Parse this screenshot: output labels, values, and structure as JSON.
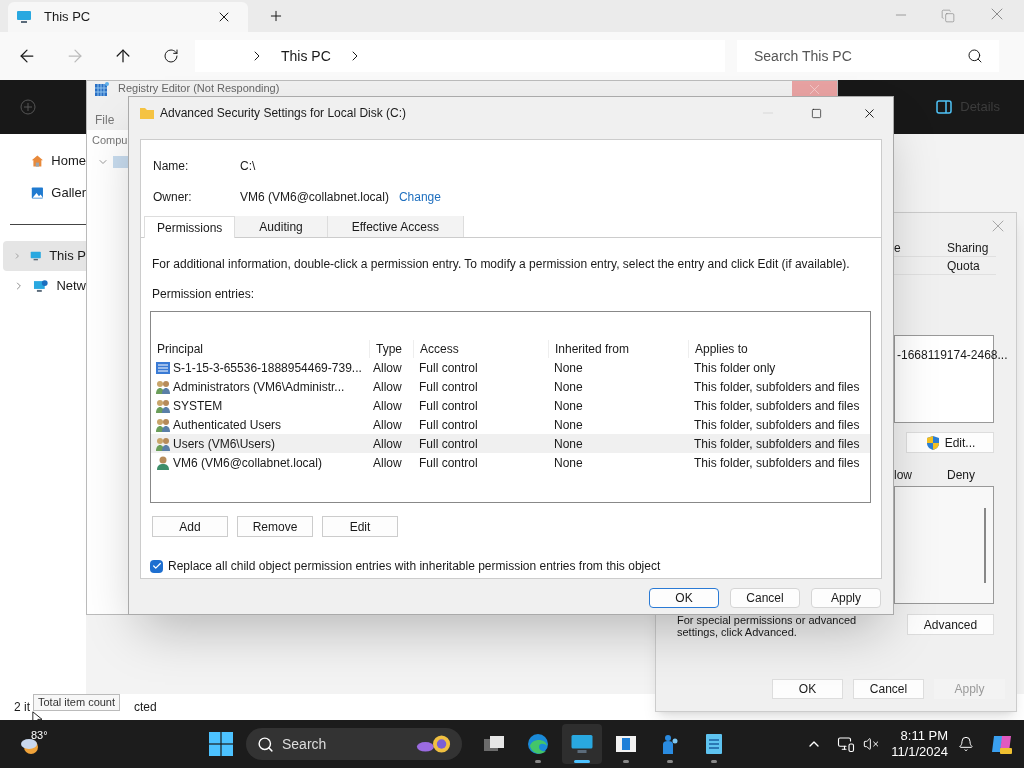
{
  "explorer": {
    "tab_title": "This PC",
    "breadcrumb": [
      "This PC"
    ],
    "search": {
      "placeholder": "Search This PC"
    },
    "details_label": "Details",
    "sidebar": [
      {
        "kind": "home",
        "label": "Home",
        "selected": false,
        "expandable": false
      },
      {
        "kind": "gallery",
        "label": "Galler",
        "selected": false,
        "expandable": false
      },
      {
        "kind": "pc",
        "label": "This P",
        "selected": true,
        "expandable": true
      },
      {
        "kind": "network",
        "label": "Netw",
        "selected": false,
        "expandable": true
      }
    ],
    "status": [
      "2 it",
      "cted"
    ],
    "tooltip": "Total item count"
  },
  "registry_editor": {
    "title": "Registry Editor (Not Responding)",
    "menu": [
      "File"
    ],
    "address": "Compu"
  },
  "properties": {
    "tab_rows": [
      [
        "e",
        "Sharing"
      ],
      [
        "Quota"
      ]
    ],
    "object_name": "-1668119174-2468...",
    "edit_button": "Edit...",
    "columns": [
      "low",
      "Deny"
    ],
    "note": "For special permissions or advanced settings, click Advanced.",
    "advanced_button": "Advanced",
    "buttons": [
      {
        "label": "OK",
        "disabled": false
      },
      {
        "label": "Cancel",
        "disabled": false
      },
      {
        "label": "Apply",
        "disabled": true
      }
    ]
  },
  "dialog": {
    "title": "Advanced Security Settings for Local Disk (C:)",
    "name_label": "Name:",
    "name_value": "C:\\",
    "owner_label": "Owner:",
    "owner_value": "VM6 (VM6@collabnet.local)",
    "change_link": "Change",
    "tabs": [
      {
        "label": "Permissions",
        "selected": true
      },
      {
        "label": "Auditing",
        "selected": false
      },
      {
        "label": "Effective Access",
        "selected": false
      }
    ],
    "info": "For additional information, double-click a permission entry. To modify a permission entry, select the entry and click Edit (if available).",
    "entries_label": "Permission entries:",
    "columns": [
      "Principal",
      "Type",
      "Access",
      "Inherited from",
      "Applies to"
    ],
    "rows": [
      {
        "kind": "sid",
        "principal": "S-1-15-3-65536-1888954469-739...",
        "type": "Allow",
        "access": "Full control",
        "inherited": "None",
        "applies": "This folder only",
        "selected": false
      },
      {
        "kind": "group",
        "principal": "Administrators (VM6\\Administr...",
        "type": "Allow",
        "access": "Full control",
        "inherited": "None",
        "applies": "This folder, subfolders and files",
        "selected": false
      },
      {
        "kind": "group",
        "principal": "SYSTEM",
        "type": "Allow",
        "access": "Full control",
        "inherited": "None",
        "applies": "This folder, subfolders and files",
        "selected": false
      },
      {
        "kind": "group",
        "principal": "Authenticated Users",
        "type": "Allow",
        "access": "Full control",
        "inherited": "None",
        "applies": "This folder, subfolders and files",
        "selected": false
      },
      {
        "kind": "group",
        "principal": "Users (VM6\\Users)",
        "type": "Allow",
        "access": "Full control",
        "inherited": "None",
        "applies": "This folder, subfolders and files",
        "selected": true
      },
      {
        "kind": "user",
        "principal": "VM6 (VM6@collabnet.local)",
        "type": "Allow",
        "access": "Full control",
        "inherited": "None",
        "applies": "This folder, subfolders and files",
        "selected": false
      }
    ],
    "entry_buttons": [
      "Add",
      "Remove",
      "Edit"
    ],
    "replace_checkbox": {
      "label": "Replace all child object permission entries with inheritable permission entries from this object",
      "checked": true
    },
    "buttons": [
      {
        "label": "OK",
        "default": true
      },
      {
        "label": "Cancel",
        "default": false
      },
      {
        "label": "Apply",
        "default": false
      }
    ]
  },
  "taskbar": {
    "weather": "83°",
    "search_placeholder": "Search",
    "apps": [
      {
        "kind": "taskview",
        "active": false
      },
      {
        "kind": "edge",
        "active": false
      },
      {
        "kind": "pc",
        "active": true
      },
      {
        "kind": "media",
        "active": false
      },
      {
        "kind": "people",
        "active": false
      },
      {
        "kind": "notepad",
        "active": false
      }
    ],
    "time": "8:11 PM",
    "date": "11/1/2024"
  }
}
